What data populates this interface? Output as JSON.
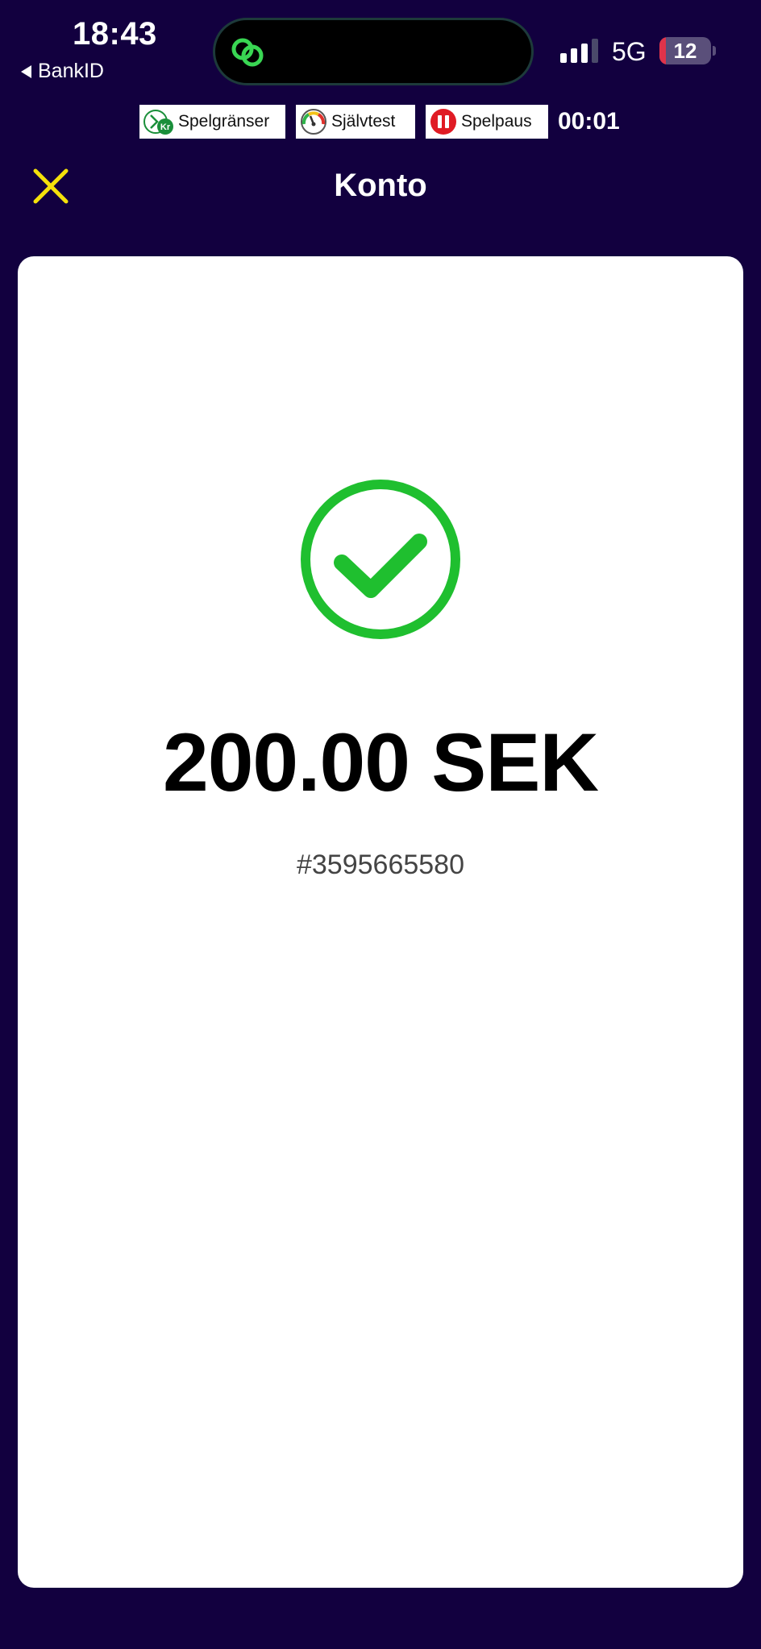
{
  "status_bar": {
    "time": "18:43",
    "back_app": "BankID",
    "network": "5G",
    "battery": "12",
    "battery_level": 0.12
  },
  "responsible_gaming": {
    "limits_label": "Spelgränser",
    "selftest_label": "Självtest",
    "pause_label": "Spelpaus",
    "session_timer": "00:01"
  },
  "header": {
    "title": "Konto"
  },
  "result": {
    "amount": "200.00 SEK",
    "reference": "#3595665580"
  },
  "colors": {
    "background": "#12003f",
    "accent_close": "#f5e10a",
    "success_green": "#1fbf2f",
    "pause_red": "#e01b24"
  },
  "icons": {
    "close": "close-icon",
    "success": "checkmark-circle-icon",
    "limits": "spelgranser-icon",
    "selftest": "gauge-icon",
    "pause": "pause-icon"
  }
}
